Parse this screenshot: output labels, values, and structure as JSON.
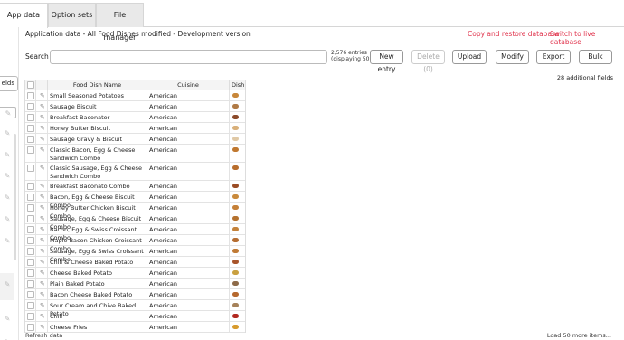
{
  "tabs": [
    {
      "label": "App data",
      "active": true
    },
    {
      "label": "Option sets",
      "active": false
    },
    {
      "label": "File manager",
      "active": false
    }
  ],
  "sidebar": {
    "fields_label": "elds"
  },
  "header": {
    "title": "Application data - All Food Dishes modified - Development version",
    "copy_restore": "Copy and restore database",
    "switch_live": "Switch to live database"
  },
  "toolbar": {
    "search_label": "Search",
    "search_placeholder": "",
    "entries_line1": "2,576 entries",
    "entries_line2": "(displaying 50)",
    "new_entry": "New entry",
    "delete": "Delete (0)",
    "upload": "Upload",
    "modify": "Modify",
    "export": "Export",
    "bulk": "Bulk"
  },
  "additional_fields": "28 additional fields",
  "table": {
    "headers": [
      "Food Dish Name",
      "Cuisine",
      "Dish Ir"
    ],
    "rows": [
      {
        "name": "Small Seasoned Potatoes",
        "cuisine": "American",
        "icon_color": "#c8873a"
      },
      {
        "name": "Sausage Biscuit",
        "cuisine": "American",
        "icon_color": "#b07a45"
      },
      {
        "name": "Breakfast Baconator",
        "cuisine": "American",
        "icon_color": "#8b4a2a"
      },
      {
        "name": "Honey Butter Biscuit",
        "cuisine": "American",
        "icon_color": "#d9b07a"
      },
      {
        "name": "Sausage Gravy & Biscuit",
        "cuisine": "American",
        "icon_color": "#e0c9a6"
      },
      {
        "name": "Classic Bacon, Egg & Cheese Sandwich Combo",
        "cuisine": "American",
        "icon_color": "#c0782f"
      },
      {
        "name": "Classic Sausage, Egg & Cheese Sandwich Combo",
        "cuisine": "American",
        "icon_color": "#b86d2c"
      },
      {
        "name": "Breakfast Baconato Combo",
        "cuisine": "American",
        "icon_color": "#9a4c24"
      },
      {
        "name": "Bacon, Egg & Cheese Biscuit Combo",
        "cuisine": "American",
        "icon_color": "#c98a3c"
      },
      {
        "name": "Honey Butter Chicken Biscuit Combo",
        "cuisine": "American",
        "icon_color": "#c58037"
      },
      {
        "name": "Sausage, Egg & Cheese Biscuit Combo",
        "cuisine": "American",
        "icon_color": "#b5722f"
      },
      {
        "name": "Bacon, Egg & Swiss Croissant Combo",
        "cuisine": "American",
        "icon_color": "#c4823a"
      },
      {
        "name": "Maple Bacon Chicken Croissant Combo",
        "cuisine": "American",
        "icon_color": "#b66d31"
      },
      {
        "name": "Sausage, Egg & Swiss Croissant Combo",
        "cuisine": "American",
        "icon_color": "#c07a35"
      },
      {
        "name": "Chili & Cheese Baked Potato",
        "cuisine": "American",
        "icon_color": "#a8542a"
      },
      {
        "name": "Cheese Baked Potato",
        "cuisine": "American",
        "icon_color": "#c9a040"
      },
      {
        "name": "Plain Baked Potato",
        "cuisine": "American",
        "icon_color": "#8d6a48"
      },
      {
        "name": "Bacon Cheese Baked Potato",
        "cuisine": "American",
        "icon_color": "#b5682e"
      },
      {
        "name": "Sour Cream and Chive Baked Potato",
        "cuisine": "American",
        "icon_color": "#a6825a"
      },
      {
        "name": "Chili",
        "cuisine": "American",
        "icon_color": "#b2281f"
      },
      {
        "name": "Cheese Fries",
        "cuisine": "American",
        "icon_color": "#d79a2c"
      }
    ]
  },
  "footer": {
    "refresh": "Refresh data",
    "load_more": "Load 50 more items..."
  }
}
